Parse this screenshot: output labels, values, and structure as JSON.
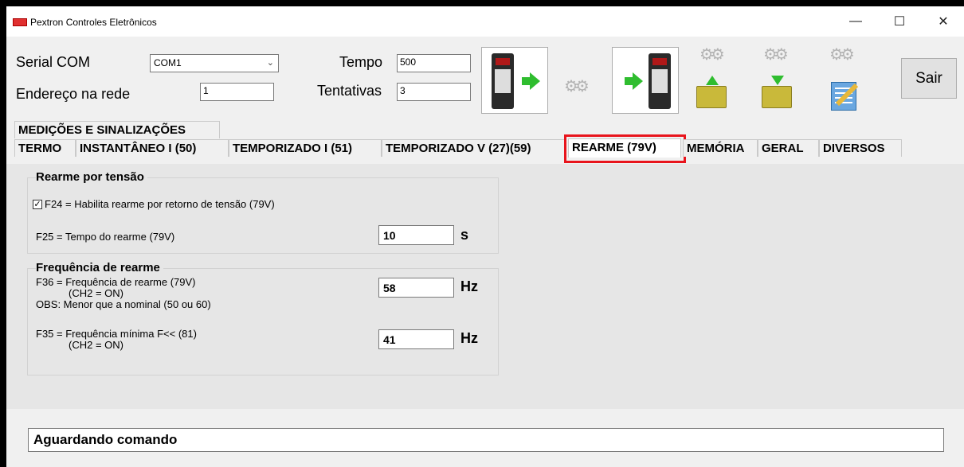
{
  "window": {
    "title": "Pextron Controles Eletrônicos",
    "minimize_glyph": "—",
    "maximize_glyph": "☐",
    "close_glyph": "✕"
  },
  "form": {
    "serial_label": "Serial COM",
    "serial_value": "COM1",
    "endereco_label": "Endereço na rede",
    "endereco_value": "1",
    "tempo_label": "Tempo",
    "tempo_value": "500",
    "tentativas_label": "Tentativas",
    "tentativas_value": "3",
    "sair_label": "Sair"
  },
  "tabs_row1": [
    "MEDIÇÕES E SINALIZAÇÕES"
  ],
  "tabs_row2": [
    "TERMO",
    "INSTANTÂNEO I (50)",
    "TEMPORIZADO I (51)",
    "TEMPORIZADO V (27)(59)",
    "REARME (79V)",
    "MEMÓRIA",
    "GERAL",
    "DIVERSOS"
  ],
  "selected_tab": "REARME (79V)",
  "rearme_tensao": {
    "title": "Rearme por tensão",
    "f24_label": "F24 = Habilita rearme por retorno de tensão (79V)",
    "f24_checked": true,
    "f25_label": "F25 = Tempo do rearme (79V)",
    "f25_value": "10",
    "f25_unit": "s"
  },
  "freq_rearme": {
    "title": "Frequência de rearme",
    "f36_line1": "F36 = Frequência de rearme (79V)",
    "f36_line2": "(CH2 = ON)",
    "f36_obs": "OBS: Menor que a nominal (50 ou 60)",
    "f36_value": "58",
    "f36_unit": "Hz",
    "f35_line1": "F35 = Frequência mínima F<< (81)",
    "f35_line2": "(CH2 = ON)",
    "f35_value": "41",
    "f35_unit": "Hz"
  },
  "status": {
    "text": "Aguardando comando"
  },
  "colors": {
    "highlight": "#e8141c",
    "panel": "#e6e6e6",
    "form": "#f0f0f0"
  }
}
